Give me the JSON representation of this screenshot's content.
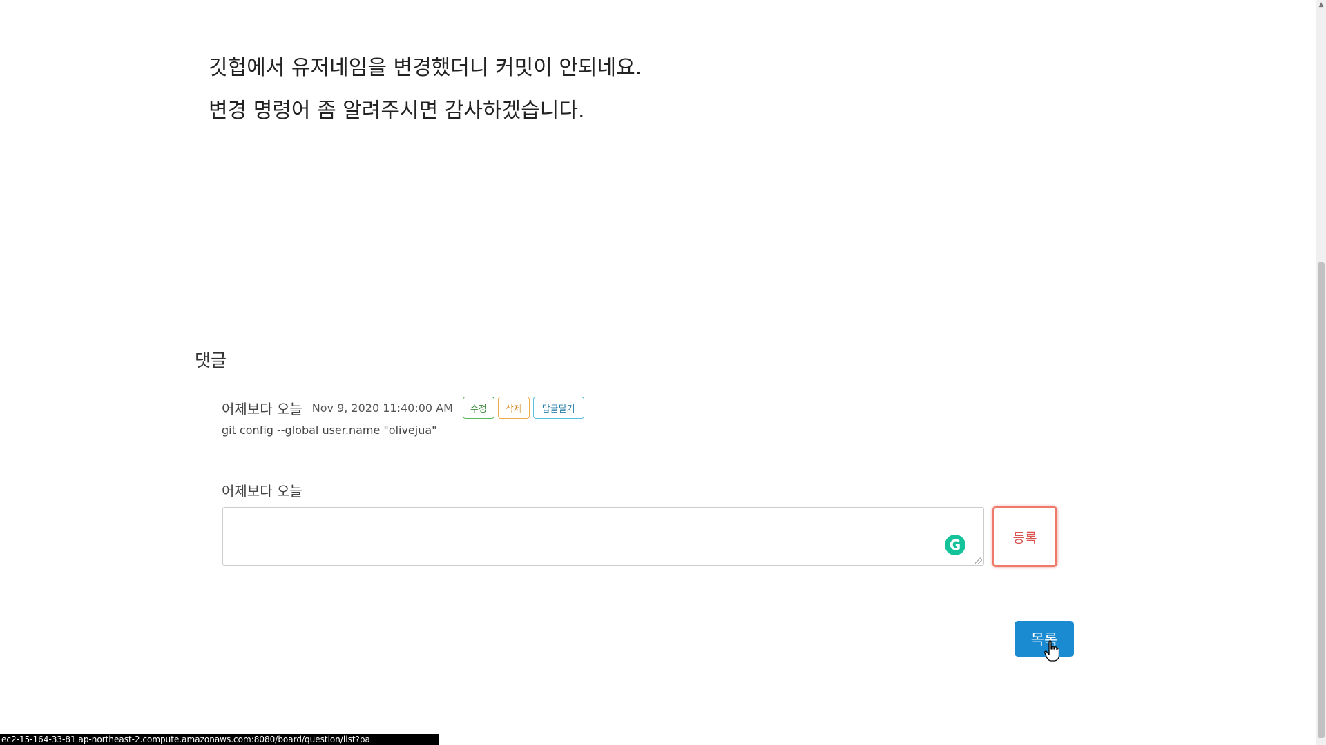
{
  "post": {
    "lines": [
      "깃헙에서 유저네임을 변경했더니 커밋이 안되네요.",
      "변경 명령어 좀 알려주시면 감사하겠습니다."
    ]
  },
  "comments": {
    "heading": "댓글",
    "items": [
      {
        "author": "어제보다 오늘",
        "date": "Nov 9, 2020 11:40:00 AM",
        "edit_label": "수정",
        "delete_label": "삭제",
        "reply_label": "답글달기",
        "text": "git config --global user.name \"olivejua\""
      }
    ]
  },
  "reply_form": {
    "author": "어제보다 오늘",
    "value": "",
    "submit_label": "등록",
    "grammarly_glyph": "G"
  },
  "list_button": {
    "label": "목록"
  },
  "status_bar": {
    "url": "ec2-15-164-33-81.ap-northeast-2.compute.amazonaws.com:8080/board/question/list?pa"
  },
  "icons": {
    "grammarly": "grammarly-icon",
    "cursor": "hand-pointer-icon"
  },
  "colors": {
    "edit": "#5cb85c",
    "delete": "#f0ad4e",
    "reply": "#5bc0de",
    "submit": "#d9534f",
    "list_button": "#1a8ad1",
    "grammarly": "#15c39a"
  }
}
